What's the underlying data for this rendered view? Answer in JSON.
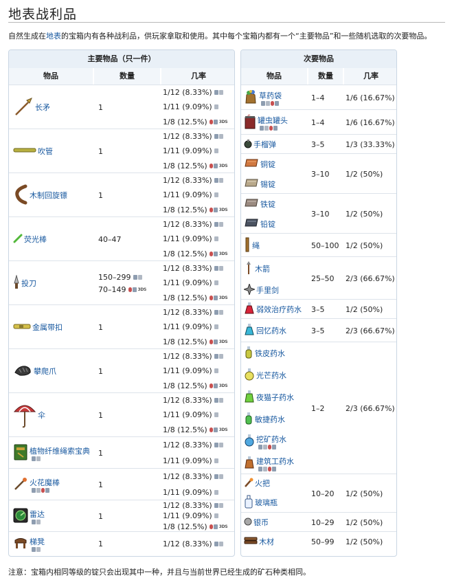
{
  "title": "地表战利品",
  "intro": {
    "before": "自然生成在",
    "link": "地表",
    "after": "的宝箱内有各种战利品，供玩家拿取和使用。其中每个宝箱内都有一个“主要物品”和一些随机选取的次要物品。"
  },
  "primary": {
    "title": "主要物品（只一件）",
    "headers": {
      "item": "物品",
      "qty": "数量",
      "rate": "几率"
    },
    "rows": [
      {
        "name": "长矛",
        "icon": "spear-icon",
        "qty": "1",
        "rates": [
          "1/12 (8.33%)",
          "1/11 (9.09%)",
          "1/8 (12.5%)"
        ]
      },
      {
        "name": "吹管",
        "icon": "blowpipe-icon",
        "qty": "1",
        "rates": [
          "1/12 (8.33%)",
          "1/11 (9.09%)",
          "1/8 (12.5%)"
        ]
      },
      {
        "name": "木制回旋镖",
        "icon": "boomerang-icon",
        "qty": "1",
        "rates": [
          "1/12 (8.33%)",
          "1/11 (9.09%)",
          "1/8 (12.5%)"
        ]
      },
      {
        "name": "荧光棒",
        "icon": "glowstick-icon",
        "qty": "40–47",
        "rates": [
          "1/12 (8.33%)",
          "1/11 (9.09%)",
          "1/8 (12.5%)"
        ]
      },
      {
        "name": "投刀",
        "icon": "throwing-knife-icon",
        "qty": "150–299",
        "qty2": "70–149",
        "rates": [
          "1/12 (8.33%)",
          "1/11 (9.09%)",
          "1/8 (12.5%)"
        ]
      },
      {
        "name": "金属带扣",
        "icon": "metal-buckle-icon",
        "qty": "1",
        "rates": [
          "1/12 (8.33%)",
          "1/11 (9.09%)",
          "1/8 (12.5%)"
        ]
      },
      {
        "name": "攀爬爪",
        "icon": "climbing-claws-icon",
        "qty": "1",
        "rates": [
          "1/12 (8.33%)",
          "1/11 (9.09%)",
          "1/8 (12.5%)"
        ]
      },
      {
        "name": "伞",
        "icon": "umbrella-icon",
        "qty": "1",
        "rates": [
          "1/12 (8.33%)",
          "1/11 (9.09%)",
          "1/8 (12.5%)"
        ]
      },
      {
        "name": "植物纤维绳索宝典",
        "icon": "rope-book-icon",
        "qty": "1",
        "rates": [
          "1/12 (8.33%)",
          "1/11 (9.09%)"
        ]
      },
      {
        "name": "火花魔棒",
        "icon": "wand-of-sparking-icon",
        "qty": "1",
        "rates": [
          "1/12 (8.33%)",
          "1/11 (9.09%)"
        ]
      },
      {
        "name": "雷达",
        "icon": "radar-icon",
        "qty": "1",
        "rates": [
          "1/12 (8.33%)",
          "1/11 (9.09%)",
          "1/8 (12.5%)"
        ]
      },
      {
        "name": "梯凳",
        "icon": "step-stool-icon",
        "qty": "1",
        "rates": [
          "1/12 (8.33%)"
        ]
      }
    ]
  },
  "secondary": {
    "title": "次要物品",
    "headers": {
      "item": "物品",
      "qty": "数量",
      "rate": "几率"
    },
    "rows": [
      {
        "names": [
          "草药袋"
        ],
        "icons": [
          "herb-bag-icon"
        ],
        "qty": "1–4",
        "rate": "1/6 (16.67%)"
      },
      {
        "names": [
          "罐虫罐头"
        ],
        "icons": [
          "can-of-worms-icon"
        ],
        "qty": "1–4",
        "rate": "1/6 (16.67%)"
      },
      {
        "names": [
          "手榴弹"
        ],
        "icons": [
          "grenade-icon"
        ],
        "qty": "3–5",
        "rate": "1/3 (33.33%)"
      },
      {
        "names": [
          "铜锭",
          "锡锭"
        ],
        "icons": [
          "copper-bar-icon",
          "tin-bar-icon"
        ],
        "qty": "3–10",
        "rate": "1/2 (50%)"
      },
      {
        "names": [
          "铁锭",
          "铅锭"
        ],
        "icons": [
          "iron-bar-icon",
          "lead-bar-icon"
        ],
        "qty": "3–10",
        "rate": "1/2 (50%)"
      },
      {
        "names": [
          "绳"
        ],
        "icons": [
          "rope-icon"
        ],
        "qty": "50–100",
        "rate": "1/2 (50%)"
      },
      {
        "names": [
          "木箭",
          "手里剑"
        ],
        "icons": [
          "wooden-arrow-icon",
          "shuriken-icon"
        ],
        "qty": "25–50",
        "rate": "2/3 (66.67%)"
      },
      {
        "names": [
          "弱效治疗药水"
        ],
        "icons": [
          "healing-potion-icon"
        ],
        "qty": "3–5",
        "rate": "1/2 (50%)"
      },
      {
        "names": [
          "回忆药水"
        ],
        "icons": [
          "recall-potion-icon"
        ],
        "qty": "3–5",
        "rate": "2/3 (66.67%)"
      },
      {
        "names": [
          "铁皮药水",
          "光芒药水",
          "夜猫子药水",
          "敏捷药水",
          "挖矿药水",
          "建筑工药水"
        ],
        "icons": [
          "ironskin-potion-icon",
          "shine-potion-icon",
          "night-owl-potion-icon",
          "swiftness-potion-icon",
          "mining-potion-icon",
          "builder-potion-icon"
        ],
        "qty": "1–2",
        "rate": "2/3 (66.67%)"
      },
      {
        "names": [
          "火把",
          "玻璃瓶"
        ],
        "icons": [
          "torch-icon",
          "bottle-icon"
        ],
        "qty": "10–20",
        "rate": "1/2 (50%)"
      },
      {
        "names": [
          "银币"
        ],
        "icons": [
          "silver-coin-icon"
        ],
        "qty": "10–29",
        "rate": "1/2 (50%)"
      },
      {
        "names": [
          "木材"
        ],
        "icons": [
          "wood-icon"
        ],
        "qty": "50–99",
        "rate": "1/2 (50%)"
      }
    ]
  },
  "platform_3ds": "3DS",
  "note": "注意：宝箱内相同等级的锭只会出现其中一种，并且与当前世界已经生成的矿石种类相同。"
}
